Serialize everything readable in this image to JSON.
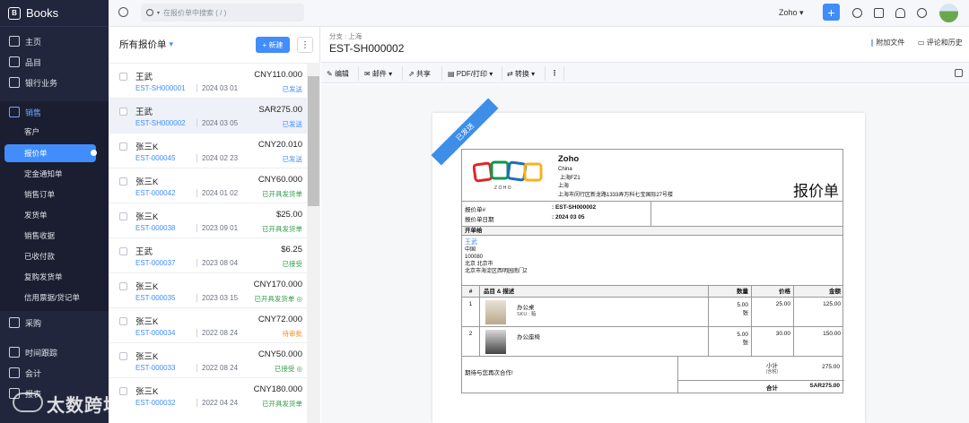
{
  "app": {
    "brand": "Books"
  },
  "sidebar": {
    "items": [
      {
        "label": "主页"
      },
      {
        "label": "品目"
      },
      {
        "label": "银行业务"
      },
      {
        "label": "销售"
      },
      {
        "label": "采购"
      },
      {
        "label": "时间跟踪"
      },
      {
        "label": "会计"
      },
      {
        "label": "报表"
      }
    ],
    "sales_sub": [
      "客户",
      "报价单",
      "定金通知单",
      "销售订单",
      "发货单",
      "销售收据",
      "已收付款",
      "复购发货单",
      "信用票据/贷记单"
    ]
  },
  "topbar": {
    "search_placeholder": "在报价单中搜索 ( / )",
    "org": "Zoho"
  },
  "list": {
    "header": "所有报价单",
    "new_label": "+ 新建",
    "more_label": "⋮",
    "rows": [
      {
        "name": "王武",
        "no": "EST-SH000001",
        "date": "2024 03 01",
        "amount": "CNY110.000",
        "status": "已发送",
        "status_color": "#408dfb"
      },
      {
        "name": "王武",
        "no": "EST-SH000002",
        "date": "2024 03 05",
        "amount": "SAR275.00",
        "status": "已发送",
        "status_color": "#408dfb"
      },
      {
        "name": "张三K",
        "no": "EST-000045",
        "date": "2024 02 23",
        "amount": "CNY20.010",
        "status": "已发送",
        "status_color": "#408dfb"
      },
      {
        "name": "张三K",
        "no": "EST-000042",
        "date": "2024 01 02",
        "amount": "CNY60.000",
        "status": "已开具发货单",
        "status_color": "#2e9d4a"
      },
      {
        "name": "张三K",
        "no": "EST-000038",
        "date": "2023 09 01",
        "amount": "$25.00",
        "status": "已开具发货单",
        "status_color": "#2e9d4a"
      },
      {
        "name": "王武",
        "no": "EST-000037",
        "date": "2023 08 04",
        "amount": "$6.25",
        "status": "已接受",
        "status_color": "#2e9d4a"
      },
      {
        "name": "张三K",
        "no": "EST-000035",
        "date": "2023 03 15",
        "amount": "CNY170.000",
        "status": "已开具发货单 ◎",
        "status_color": "#2e9d4a"
      },
      {
        "name": "张三K",
        "no": "EST-000034",
        "date": "2022 08 24",
        "amount": "CNY72.000",
        "status": "待审批",
        "status_color": "#f08a24"
      },
      {
        "name": "张三K",
        "no": "EST-000033",
        "date": "2022 08 24",
        "amount": "CNY50.000",
        "status": "已接受 ◎",
        "status_color": "#2e9d4a"
      },
      {
        "name": "张三K",
        "no": "EST-000032",
        "date": "2022 04 24",
        "amount": "CNY180.000",
        "status": "已开具发货单",
        "status_color": "#2e9d4a"
      }
    ]
  },
  "detail": {
    "branch": "分支 : 上海",
    "title": "EST-SH000002",
    "attach": "附加文件",
    "comments": "评论和历史",
    "toolbar": {
      "edit": "编辑",
      "mail": "邮件 ▾",
      "share": "共享",
      "pdf": "PDF/打印 ▾",
      "convert": "转换 ▾",
      "more": "⋮"
    }
  },
  "quote": {
    "ribbon": "已发送",
    "company": "Zoho",
    "company_addr": [
      "China",
      "上海FZ1",
      "上海",
      "上海市闵行区新龙路1333弄万科七宝国际27号楼"
    ],
    "doc_title": "报价单",
    "no_label": "报价单#",
    "no_value": ": EST-SH000002",
    "date_label": "报价单日期",
    "date_value": ": 2024 03 05",
    "bill_to": "开单给",
    "customer": "王武",
    "cust_addr": [
      "中国",
      "100080",
      "北京 北京市",
      "北京市海淀区西明园南门Z"
    ],
    "cols": {
      "no": "#",
      "item": "品目 & 描述",
      "qty": "数量",
      "rate": "价格",
      "amount": "金额"
    },
    "items": [
      {
        "no": "1",
        "name": "办公桌",
        "sku": "SKU : 箱",
        "qty": "5.00",
        "unit": "张",
        "rate": "25.00",
        "amount": "125.00"
      },
      {
        "no": "2",
        "name": "办公座椅",
        "sku": "",
        "qty": "5.00",
        "unit": "张",
        "rate": "30.00",
        "amount": "150.00"
      }
    ],
    "thanks": "期待与您再次合作!",
    "subtotal_label": "小计",
    "subtotal_sub": "(含税)",
    "subtotal": "275.00",
    "total_label": "合计",
    "total": "SAR275.00"
  }
}
